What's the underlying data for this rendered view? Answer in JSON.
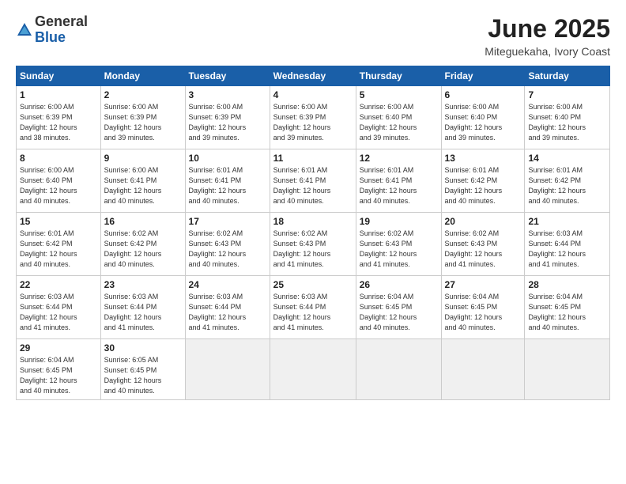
{
  "header": {
    "logo_line1": "General",
    "logo_line2": "Blue",
    "month": "June 2025",
    "location": "Miteguekaha, Ivory Coast"
  },
  "weekdays": [
    "Sunday",
    "Monday",
    "Tuesday",
    "Wednesday",
    "Thursday",
    "Friday",
    "Saturday"
  ],
  "weeks": [
    [
      {
        "day": "1",
        "info": "Sunrise: 6:00 AM\nSunset: 6:39 PM\nDaylight: 12 hours\nand 38 minutes."
      },
      {
        "day": "2",
        "info": "Sunrise: 6:00 AM\nSunset: 6:39 PM\nDaylight: 12 hours\nand 39 minutes."
      },
      {
        "day": "3",
        "info": "Sunrise: 6:00 AM\nSunset: 6:39 PM\nDaylight: 12 hours\nand 39 minutes."
      },
      {
        "day": "4",
        "info": "Sunrise: 6:00 AM\nSunset: 6:39 PM\nDaylight: 12 hours\nand 39 minutes."
      },
      {
        "day": "5",
        "info": "Sunrise: 6:00 AM\nSunset: 6:40 PM\nDaylight: 12 hours\nand 39 minutes."
      },
      {
        "day": "6",
        "info": "Sunrise: 6:00 AM\nSunset: 6:40 PM\nDaylight: 12 hours\nand 39 minutes."
      },
      {
        "day": "7",
        "info": "Sunrise: 6:00 AM\nSunset: 6:40 PM\nDaylight: 12 hours\nand 39 minutes."
      }
    ],
    [
      {
        "day": "8",
        "info": "Sunrise: 6:00 AM\nSunset: 6:40 PM\nDaylight: 12 hours\nand 40 minutes."
      },
      {
        "day": "9",
        "info": "Sunrise: 6:00 AM\nSunset: 6:41 PM\nDaylight: 12 hours\nand 40 minutes."
      },
      {
        "day": "10",
        "info": "Sunrise: 6:01 AM\nSunset: 6:41 PM\nDaylight: 12 hours\nand 40 minutes."
      },
      {
        "day": "11",
        "info": "Sunrise: 6:01 AM\nSunset: 6:41 PM\nDaylight: 12 hours\nand 40 minutes."
      },
      {
        "day": "12",
        "info": "Sunrise: 6:01 AM\nSunset: 6:41 PM\nDaylight: 12 hours\nand 40 minutes."
      },
      {
        "day": "13",
        "info": "Sunrise: 6:01 AM\nSunset: 6:42 PM\nDaylight: 12 hours\nand 40 minutes."
      },
      {
        "day": "14",
        "info": "Sunrise: 6:01 AM\nSunset: 6:42 PM\nDaylight: 12 hours\nand 40 minutes."
      }
    ],
    [
      {
        "day": "15",
        "info": "Sunrise: 6:01 AM\nSunset: 6:42 PM\nDaylight: 12 hours\nand 40 minutes."
      },
      {
        "day": "16",
        "info": "Sunrise: 6:02 AM\nSunset: 6:42 PM\nDaylight: 12 hours\nand 40 minutes."
      },
      {
        "day": "17",
        "info": "Sunrise: 6:02 AM\nSunset: 6:43 PM\nDaylight: 12 hours\nand 40 minutes."
      },
      {
        "day": "18",
        "info": "Sunrise: 6:02 AM\nSunset: 6:43 PM\nDaylight: 12 hours\nand 41 minutes."
      },
      {
        "day": "19",
        "info": "Sunrise: 6:02 AM\nSunset: 6:43 PM\nDaylight: 12 hours\nand 41 minutes."
      },
      {
        "day": "20",
        "info": "Sunrise: 6:02 AM\nSunset: 6:43 PM\nDaylight: 12 hours\nand 41 minutes."
      },
      {
        "day": "21",
        "info": "Sunrise: 6:03 AM\nSunset: 6:44 PM\nDaylight: 12 hours\nand 41 minutes."
      }
    ],
    [
      {
        "day": "22",
        "info": "Sunrise: 6:03 AM\nSunset: 6:44 PM\nDaylight: 12 hours\nand 41 minutes."
      },
      {
        "day": "23",
        "info": "Sunrise: 6:03 AM\nSunset: 6:44 PM\nDaylight: 12 hours\nand 41 minutes."
      },
      {
        "day": "24",
        "info": "Sunrise: 6:03 AM\nSunset: 6:44 PM\nDaylight: 12 hours\nand 41 minutes."
      },
      {
        "day": "25",
        "info": "Sunrise: 6:03 AM\nSunset: 6:44 PM\nDaylight: 12 hours\nand 41 minutes."
      },
      {
        "day": "26",
        "info": "Sunrise: 6:04 AM\nSunset: 6:45 PM\nDaylight: 12 hours\nand 40 minutes."
      },
      {
        "day": "27",
        "info": "Sunrise: 6:04 AM\nSunset: 6:45 PM\nDaylight: 12 hours\nand 40 minutes."
      },
      {
        "day": "28",
        "info": "Sunrise: 6:04 AM\nSunset: 6:45 PM\nDaylight: 12 hours\nand 40 minutes."
      }
    ],
    [
      {
        "day": "29",
        "info": "Sunrise: 6:04 AM\nSunset: 6:45 PM\nDaylight: 12 hours\nand 40 minutes."
      },
      {
        "day": "30",
        "info": "Sunrise: 6:05 AM\nSunset: 6:45 PM\nDaylight: 12 hours\nand 40 minutes."
      },
      {
        "day": "",
        "info": ""
      },
      {
        "day": "",
        "info": ""
      },
      {
        "day": "",
        "info": ""
      },
      {
        "day": "",
        "info": ""
      },
      {
        "day": "",
        "info": ""
      }
    ]
  ]
}
